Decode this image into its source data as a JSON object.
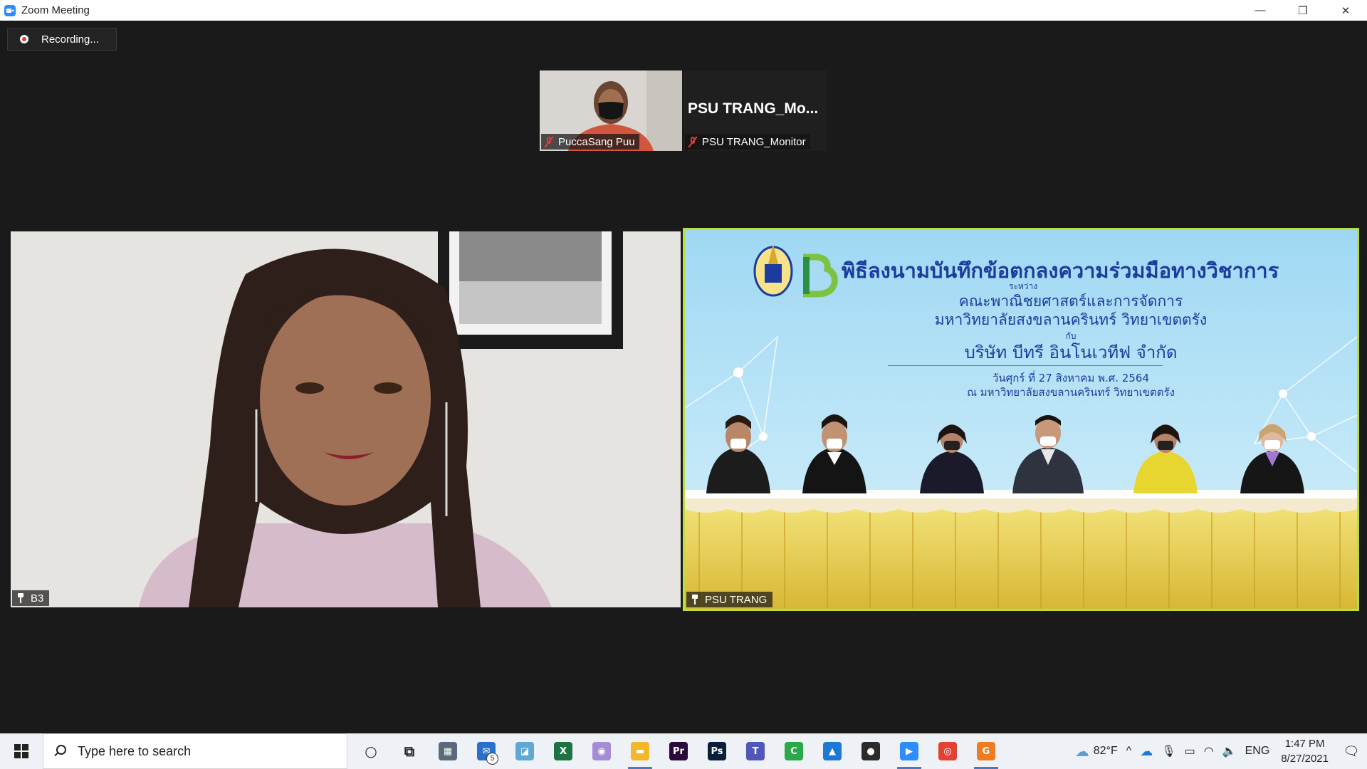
{
  "window": {
    "title": "Zoom Meeting",
    "minimize": "—",
    "restore": "❐",
    "close": "✕"
  },
  "recording": {
    "label": "Recording..."
  },
  "thumbnails": [
    {
      "name": "PuccaSang Puu"
    },
    {
      "display_name": "PSU  TRANG_Mo...",
      "name": "PSU TRANG_Monitor"
    }
  ],
  "tiles": [
    {
      "name": "B3"
    },
    {
      "name": "PSU TRANG"
    }
  ],
  "banner": {
    "title": "พิธีลงนามบันทึกข้อตกลงความร่วมมือทางวิชาการ",
    "between": "ระหว่าง",
    "line2": "คณะพาณิชยศาสตร์และการจัดการ",
    "line3": "มหาวิทยาลัยสงขลานครินทร์ วิทยาเขตตรัง",
    "with": "กับ",
    "company": "บริษัท บีทรี อินโนเวทีฟ จำกัด",
    "date": "วันศุกร์ ที่ 27  สิงหาคม พ.ศ. 2564",
    "venue": "ณ มหาวิทยาลัยสงขลานครินทร์ วิทยาเขตตรัง"
  },
  "taskbar": {
    "search_placeholder": "Type here to search",
    "mail_badge": "5",
    "weather": "82°F",
    "language": "ENG",
    "time": "1:47 PM",
    "date": "8/27/2021",
    "apps": [
      {
        "name": "cortana",
        "glyph": "○",
        "color": "transparent"
      },
      {
        "name": "task-view",
        "glyph": "⧉",
        "color": "transparent"
      },
      {
        "name": "calculator",
        "glyph": "▦",
        "color": "#5a6a7a"
      },
      {
        "name": "mail",
        "glyph": "✉",
        "color": "#2a6fc9"
      },
      {
        "name": "sticky",
        "glyph": "◪",
        "color": "#5fa8d3"
      },
      {
        "name": "excel",
        "glyph": "X",
        "color": "#1f7244"
      },
      {
        "name": "paint",
        "glyph": "◉",
        "color": "#a58cd6"
      },
      {
        "name": "explorer",
        "glyph": "▬",
        "color": "#f2b829"
      },
      {
        "name": "premiere",
        "glyph": "Pr",
        "color": "#2a0a3a"
      },
      {
        "name": "photoshop",
        "glyph": "Ps",
        "color": "#0a1f3a"
      },
      {
        "name": "teams",
        "glyph": "T",
        "color": "#5057b8"
      },
      {
        "name": "camtasia",
        "glyph": "C",
        "color": "#2ba84a"
      },
      {
        "name": "whiteboard",
        "glyph": "▲",
        "color": "#1e78d6"
      },
      {
        "name": "obs",
        "glyph": "●",
        "color": "#2b2b2b"
      },
      {
        "name": "zoom",
        "glyph": "▶",
        "color": "#2d8cff"
      },
      {
        "name": "chrome",
        "glyph": "◎",
        "color": "#e34133"
      },
      {
        "name": "pdf",
        "glyph": "G",
        "color": "#f07c22"
      }
    ]
  }
}
